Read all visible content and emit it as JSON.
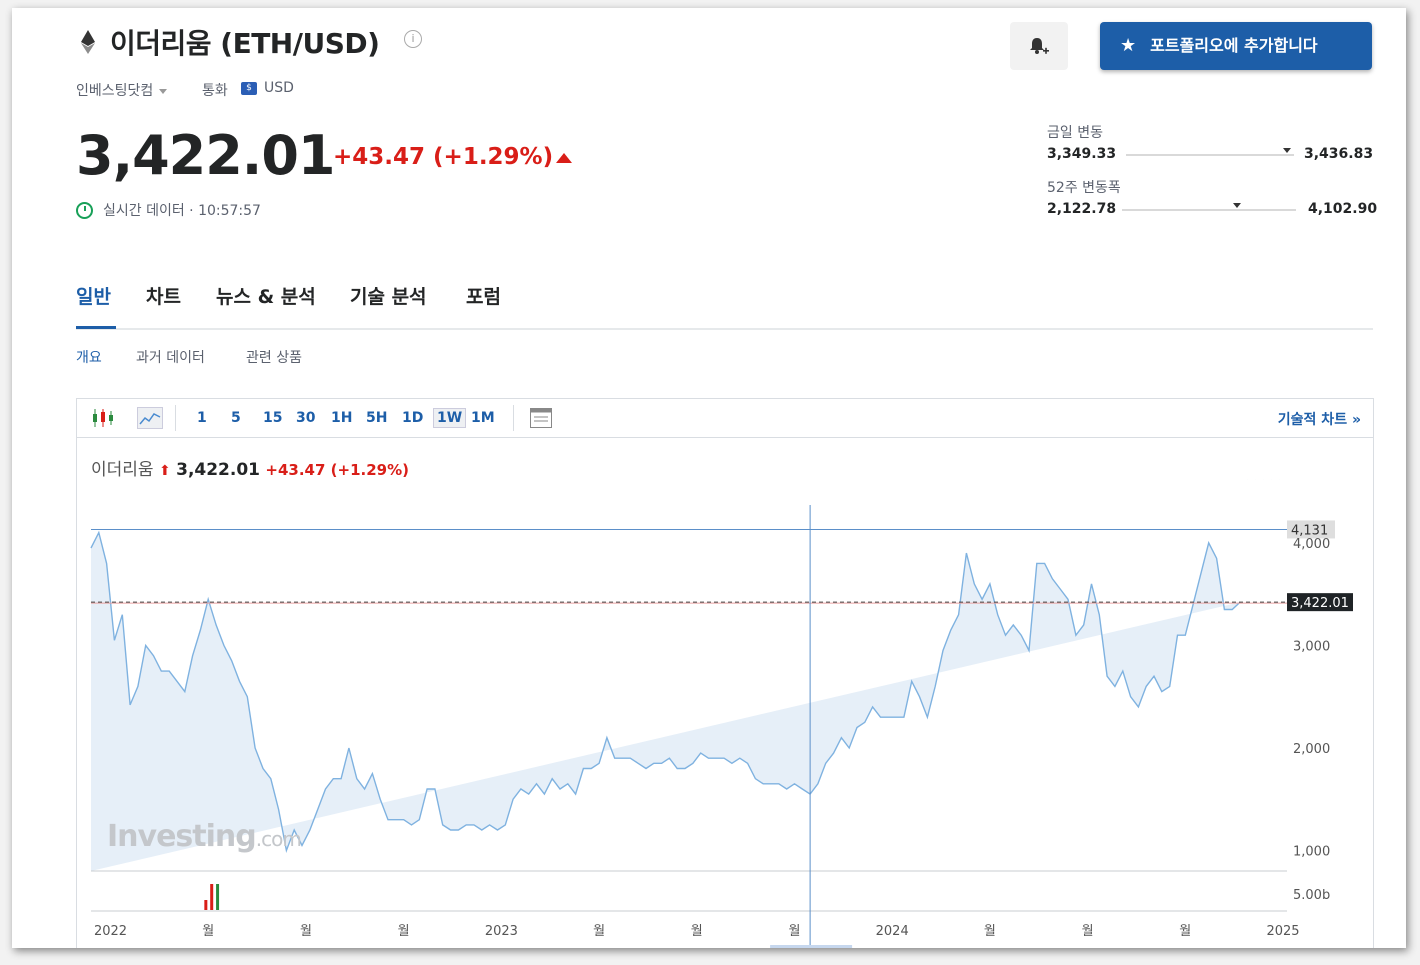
{
  "header": {
    "title": "이더리움 (ETH/USD)",
    "provider": "인베스팅닷컴",
    "currency_label": "통화",
    "currency": "USD"
  },
  "quote": {
    "price": "3,422.01",
    "change": "+43.47 (+1.29%)",
    "status": "실시간 데이터 · 10:57:57"
  },
  "buttons": {
    "portfolio": "포트폴리오에 추가합니다"
  },
  "ranges": {
    "day_label": "금일 변동",
    "day_low": "3,349.33",
    "day_high": "3,436.83",
    "week52_label": "52주 변동폭",
    "week52_low": "2,122.78",
    "week52_high": "4,102.90",
    "day_marker_fraction": 0.96,
    "week52_marker_fraction": 0.66
  },
  "tabs": [
    "일반",
    "차트",
    "뉴스 & 분석",
    "기술 분석",
    "포럼"
  ],
  "subtabs": [
    "개요",
    "과거 데이터",
    "관련 상품"
  ],
  "toolbar": {
    "timeframes": [
      "1",
      "5",
      "15",
      "30",
      "1H",
      "5H",
      "1D",
      "1W",
      "1M"
    ],
    "selected": "1W",
    "tech_chart_link": "기술적 차트 »"
  },
  "chart_legend": {
    "name": "이더리움",
    "price": "3,422.01",
    "change": "+43.47 (+1.29%)"
  },
  "colors": {
    "accent": "#1d5ea8",
    "down_red": "#d91e18",
    "line": "#7fb2e0",
    "area": "#e6eff8"
  },
  "chart_data": {
    "type": "area",
    "x": [
      2021.95,
      2021.97,
      2021.99,
      2022.01,
      2022.03,
      2022.05,
      2022.07,
      2022.09,
      2022.11,
      2022.13,
      2022.15,
      2022.17,
      2022.19,
      2022.21,
      2022.23,
      2022.25,
      2022.27,
      2022.29,
      2022.31,
      2022.33,
      2022.35,
      2022.37,
      2022.39,
      2022.41,
      2022.43,
      2022.45,
      2022.47,
      2022.49,
      2022.51,
      2022.53,
      2022.55,
      2022.57,
      2022.59,
      2022.61,
      2022.63,
      2022.65,
      2022.67,
      2022.69,
      2022.71,
      2022.73,
      2022.75,
      2022.77,
      2022.79,
      2022.81,
      2022.83,
      2022.85,
      2022.87,
      2022.89,
      2022.91,
      2022.93,
      2022.95,
      2022.97,
      2022.99,
      2023.01,
      2023.03,
      2023.05,
      2023.07,
      2023.09,
      2023.11,
      2023.13,
      2023.15,
      2023.17,
      2023.19,
      2023.21,
      2023.23,
      2023.25,
      2023.27,
      2023.29,
      2023.31,
      2023.33,
      2023.35,
      2023.37,
      2023.39,
      2023.41,
      2023.43,
      2023.45,
      2023.47,
      2023.49,
      2023.51,
      2023.53,
      2023.55,
      2023.57,
      2023.59,
      2023.61,
      2023.63,
      2023.65,
      2023.67,
      2023.69,
      2023.71,
      2023.73,
      2023.75,
      2023.77,
      2023.79,
      2023.81,
      2023.83,
      2023.85,
      2023.87,
      2023.89,
      2023.91,
      2023.93,
      2023.95,
      2023.97,
      2023.99,
      2024.01,
      2024.03,
      2024.05,
      2024.07,
      2024.09,
      2024.11,
      2024.13,
      2024.15,
      2024.17,
      2024.19,
      2024.21,
      2024.23,
      2024.25,
      2024.27,
      2024.29,
      2024.31,
      2024.33,
      2024.35,
      2024.37,
      2024.39,
      2024.41,
      2024.43,
      2024.45,
      2024.47,
      2024.49,
      2024.51,
      2024.53,
      2024.55,
      2024.57,
      2024.59,
      2024.61,
      2024.63,
      2024.65,
      2024.67,
      2024.69,
      2024.71,
      2024.73,
      2024.75,
      2024.77,
      2024.79,
      2024.81,
      2024.83,
      2024.85,
      2024.87,
      2024.89,
      2024.91,
      2024.93,
      2024.95,
      2024.97,
      2024.99
    ],
    "y": [
      3950,
      4100,
      3800,
      3050,
      3300,
      2420,
      2600,
      3000,
      2900,
      2750,
      2750,
      2650,
      2550,
      2900,
      3150,
      3450,
      3200,
      3000,
      2850,
      2650,
      2500,
      2000,
      1800,
      1700,
      1400,
      1000,
      1200,
      1050,
      1200,
      1400,
      1600,
      1700,
      1700,
      2000,
      1700,
      1600,
      1750,
      1500,
      1300,
      1300,
      1300,
      1250,
      1300,
      1600,
      1600,
      1250,
      1200,
      1200,
      1250,
      1250,
      1200,
      1250,
      1200,
      1250,
      1500,
      1600,
      1550,
      1650,
      1550,
      1700,
      1600,
      1650,
      1550,
      1800,
      1800,
      1850,
      2100,
      1900,
      1900,
      1900,
      1850,
      1800,
      1850,
      1850,
      1900,
      1800,
      1800,
      1850,
      1950,
      1900,
      1900,
      1900,
      1850,
      1900,
      1850,
      1700,
      1650,
      1650,
      1650,
      1600,
      1650,
      1600,
      1550,
      1650,
      1850,
      1950,
      2100,
      2000,
      2200,
      2250,
      2400,
      2300,
      2300,
      2300,
      2300,
      2650,
      2500,
      2300,
      2600,
      2950,
      3150,
      3300,
      3900,
      3600,
      3450,
      3600,
      3300,
      3100,
      3200,
      3100,
      2950,
      3800,
      3800,
      3650,
      3550,
      3450,
      3100,
      3200,
      3600,
      3300,
      2700,
      2600,
      2750,
      2500,
      2400,
      2600,
      2700,
      2550,
      2600,
      3100,
      3100,
      3400,
      3700,
      4000,
      3850,
      3350,
      3350,
      3422
    ],
    "ylim": [
      800,
      4350
    ],
    "yticks": [
      1000,
      2000,
      3000,
      4000
    ],
    "ytick_labels": [
      "1,000",
      "2,000",
      "3,000",
      "4,000"
    ],
    "xticks": [
      2022,
      2022.25,
      2022.5,
      2022.75,
      2023,
      2023.25,
      2023.5,
      2023.75,
      2024,
      2024.25,
      2024.5,
      2024.75,
      2025
    ],
    "xtick_labels": [
      "2022",
      "월",
      "월",
      "월",
      "2023",
      "월",
      "월",
      "월",
      "2024",
      "월",
      "월",
      "월",
      "2025"
    ],
    "high_line": 4131,
    "high_label": "4,131",
    "last_price": 3422.01,
    "last_label": "3,422.01",
    "volume_label": "5.00b",
    "crosshair_x": 2023.79,
    "grid": false
  }
}
